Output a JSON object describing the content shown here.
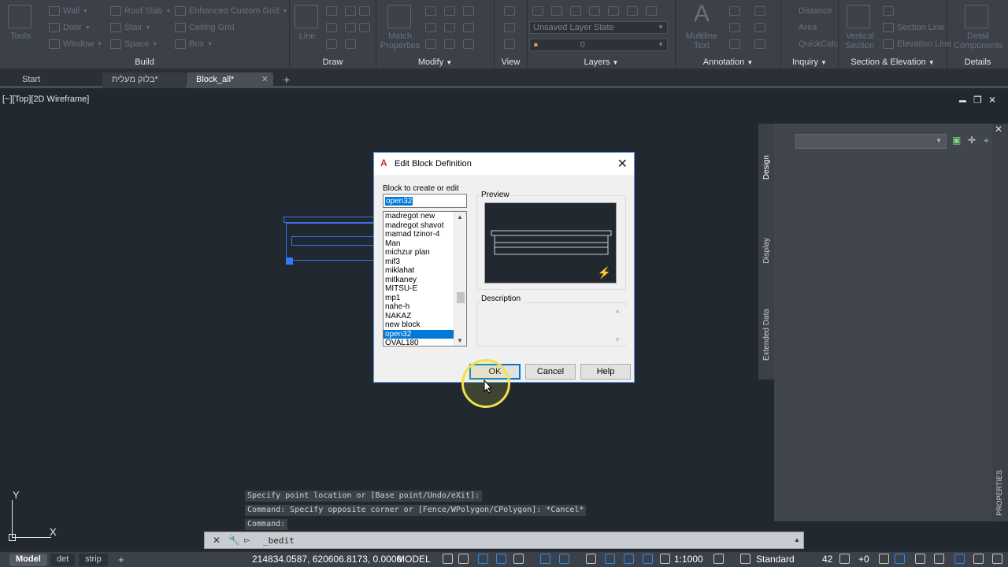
{
  "ribbon": {
    "panels": [
      {
        "title": "Build",
        "tools": [
          "Wall",
          "Door",
          "Window",
          "Roof Slab",
          "Stair",
          "Space",
          "Enhanced Custom Grid",
          "Ceiling Grid",
          "Box"
        ],
        "big": "Tools"
      },
      {
        "title": "Draw",
        "big": "Line"
      },
      {
        "title": "Modify",
        "big": "Match Properties"
      },
      {
        "title": "View"
      },
      {
        "title": "Layers",
        "layer_state": "Unsaved Layer State",
        "layer_value": "0"
      },
      {
        "title": "Annotation",
        "big": "Multiline Text"
      },
      {
        "title": "Inquiry",
        "tools": [
          "Distance",
          "Area",
          "QuickCalc"
        ]
      },
      {
        "title": "Section & Elevation",
        "tools": [
          "Section Line",
          "Elevation Line"
        ],
        "big": "Vertical Section"
      },
      {
        "title": "Details",
        "big": "Detail Components"
      }
    ]
  },
  "tabs": [
    {
      "label": "Start"
    },
    {
      "label": "בלוק מעלית*"
    },
    {
      "label": "Block_all*"
    }
  ],
  "tab_add": "+",
  "viewport": {
    "label": "[−][Top][2D Wireframe]",
    "controls": [
      "▬",
      "❐",
      "✕"
    ]
  },
  "dialog": {
    "title": "Edit Block Definition",
    "logo": "A",
    "close": "✕",
    "block_label": "Block to create or edit",
    "block_value": "open32",
    "list_items": [
      "madregot new",
      "madregot shavot",
      "mamad tzinor-4",
      "Man",
      "michzur plan",
      "mif3",
      "miklahat",
      "mitkaney",
      "MITSU-E",
      "mp1",
      "nahe-h",
      "NAKAZ",
      "new block",
      "open32",
      "OVAL180"
    ],
    "selected_index": 13,
    "preview_label": "Preview",
    "description_label": "Description",
    "buttons": {
      "ok": "OK",
      "cancel": "Cancel",
      "help": "Help"
    }
  },
  "right_panel": {
    "tabs": [
      "Design",
      "Display",
      "Extended Data"
    ],
    "side_label": "PROPERTIES"
  },
  "command": {
    "history": [
      "Specify point location or [Base point/Undo/eXit]:",
      "Command: Specify opposite corner or [Fence/WPolygon/CPolygon]: *Cancel*",
      "Command:"
    ],
    "input": "_bedit"
  },
  "ucs": {
    "x": "X",
    "y": "Y"
  },
  "status": {
    "layout_tabs": [
      "Model",
      "det",
      "strip"
    ],
    "add": "+",
    "coords": "214834.0587, 620606.8173, 0.0000",
    "model": "MODEL",
    "scale": "1:1000",
    "style": "Standard",
    "num": "42",
    "plus": "+0"
  }
}
